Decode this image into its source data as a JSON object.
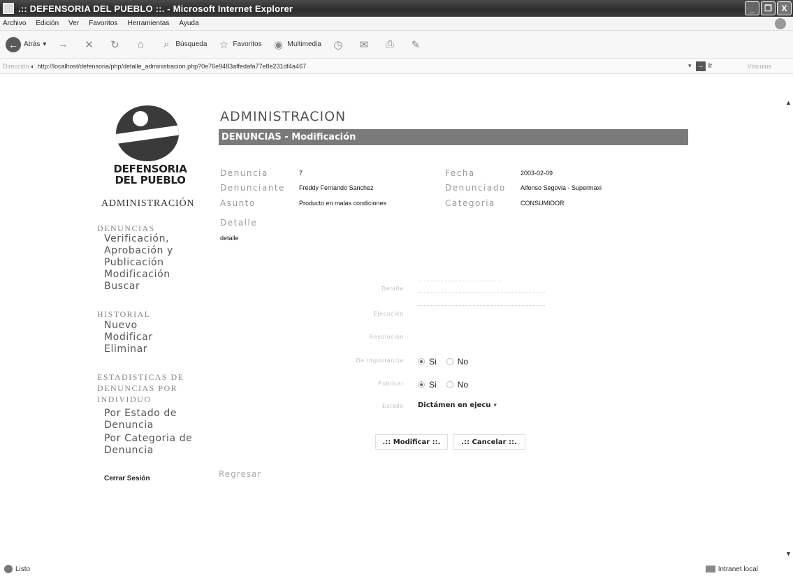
{
  "window": {
    "title": ".:: DEFENSORIA DEL PUEBLO ::. - Microsoft Internet Explorer",
    "buttons": [
      "_",
      "❐",
      "X"
    ]
  },
  "menu": [
    "Archivo",
    "Edición",
    "Ver",
    "Favoritos",
    "Herramientas",
    "Ayuda"
  ],
  "toolbar": {
    "back": "Atrás",
    "search": "Búsqueda",
    "favorites": "Favoritos",
    "media": "Multimedia"
  },
  "address": {
    "label": "Dirección",
    "url": "http://localhost/defensoria/php/detalle_administracion.php?0e76e9483affedafa77e8e231df4a467",
    "go": "Ir",
    "links": "Vínculos"
  },
  "logo": {
    "line1": "DEFENSORIA",
    "line2": "DEL PUEBLO"
  },
  "sidebar": {
    "title": "ADMINISTRACIÓN",
    "denuncias_head": "DENUNCIAS",
    "denuncias_links": [
      "Verificación,",
      "Aprobación y",
      "Publicación",
      "Modificación",
      "Buscar"
    ],
    "historial_head": "HISTORIAL",
    "historial_links": [
      "Nuevo",
      "Modificar",
      "Eliminar"
    ],
    "estadisticas_head": [
      "ESTADISTICAS DE",
      "DENUNCIAS POR",
      "INDIVIDUO"
    ],
    "estadisticas_links": [
      "Por Estado de",
      "Denuncia",
      "Por Categoria de",
      "Denuncia"
    ],
    "logout": "Cerrar Sesión"
  },
  "main": {
    "title": "ADMINISTRACION",
    "section": "DENUNCIAS - Modificación",
    "fields": {
      "denuncia_label": "Denuncia",
      "denuncia_value": "7",
      "fecha_label": "Fecha",
      "fecha_value": "2003-02-09",
      "denunciante_label": "Denunciante",
      "denunciante_value": "Freddy Fernando Sanchez",
      "denunciado_label": "Denunciado",
      "denunciado_value": "Alfonso Segovia - Supermaxi",
      "asunto_label": "Asunto",
      "asunto_value": "Producto en malas condiciones",
      "categoria_label": "Categoria",
      "categoria_value": "CONSUMIDOR",
      "detalle_label": "Detalle",
      "detalle_value": "detalle"
    },
    "form": {
      "detalle_label": "Detalle",
      "ejecucion_label": "Ejecución",
      "resolucion_label": "Resolución",
      "importancia_label": "De Importancia",
      "publicar_label": "Publicar",
      "estado_label": "Estado",
      "yes": "Si",
      "no": "No",
      "importancia_selected": "Si",
      "publicar_selected": "Si",
      "estado_value": "Dictámen en ejecu"
    },
    "buttons": {
      "modify": ".:: Modificar ::.",
      "cancel": ".:: Cancelar ::."
    },
    "back": "Regresar"
  },
  "status": {
    "left": "Listo",
    "zone": "Intranet local"
  }
}
